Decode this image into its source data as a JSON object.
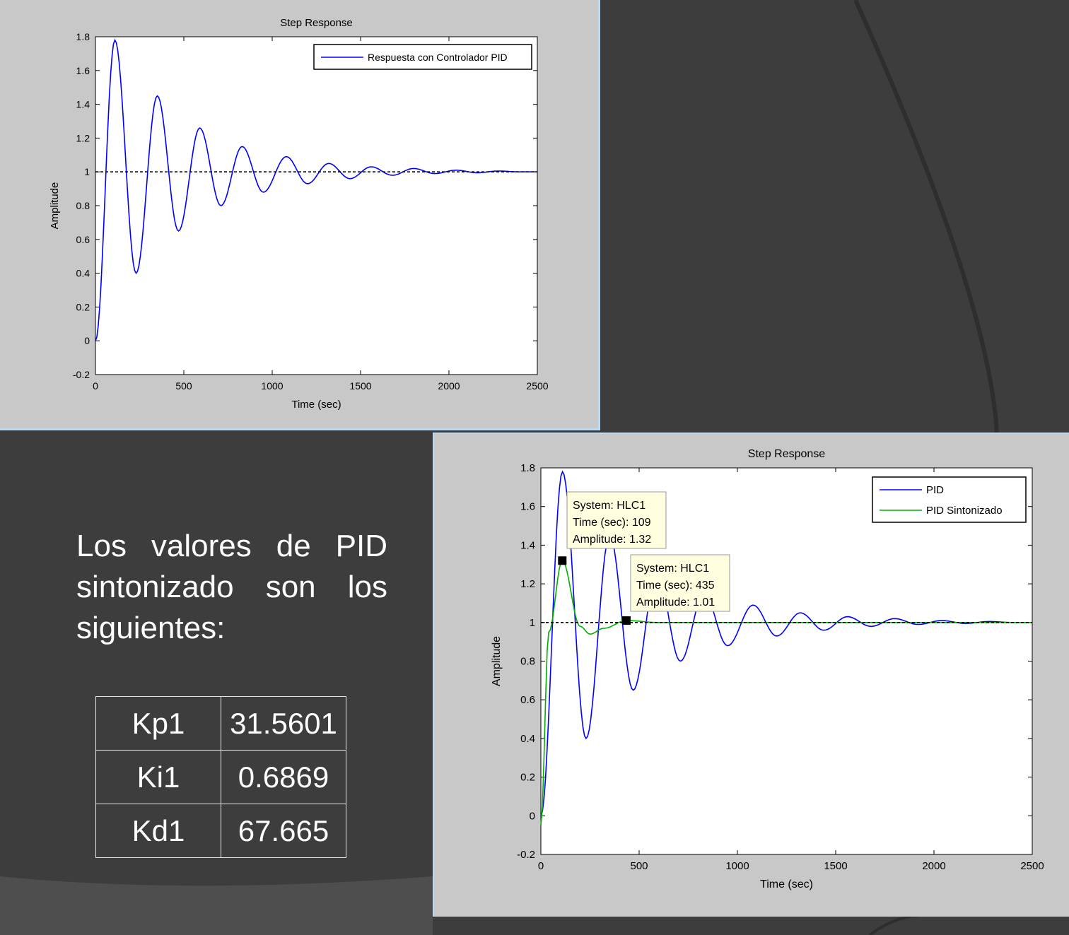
{
  "slide": {
    "description": "Los valores de PID sintonizado son los siguientes:",
    "gains_table": [
      {
        "name": "Kp1",
        "value": "31.5601"
      },
      {
        "name": "Ki1",
        "value": "0.6869"
      },
      {
        "name": "Kd1",
        "value": "67.665"
      }
    ],
    "colors": {
      "background": "#3d3d3d",
      "figure_bg": "#c8c8c8",
      "text": "#ffffff"
    }
  },
  "chart_data": [
    {
      "type": "line",
      "title": "Step Response",
      "xlabel": "Time (sec)",
      "ylabel": "Amplitude",
      "xlim": [
        0,
        2500
      ],
      "ylim": [
        -0.2,
        1.8
      ],
      "xticks": [
        "0",
        "500",
        "1000",
        "1500",
        "2000",
        "2500"
      ],
      "yticks": [
        "-0.2",
        "0",
        "0.2",
        "0.4",
        "0.6",
        "0.8",
        "1",
        "1.2",
        "1.4",
        "1.6",
        "1.8"
      ],
      "grid": false,
      "legend_position": "top-right",
      "reference_line": {
        "y": 1,
        "style": "dashed",
        "color": "#000000"
      },
      "series": [
        {
          "name": "Respuesta con Controlador PID",
          "color": "#0000ff",
          "x": [
            0,
            110,
            230,
            350,
            470,
            590,
            710,
            830,
            950,
            1080,
            1200,
            1320,
            1440,
            1560,
            1680,
            1800,
            1920,
            2040,
            2160,
            2280,
            2400,
            2500
          ],
          "y": [
            0,
            1.78,
            0.4,
            1.45,
            0.65,
            1.26,
            0.8,
            1.15,
            0.88,
            1.09,
            0.93,
            1.05,
            0.96,
            1.03,
            0.98,
            1.02,
            0.99,
            1.01,
            0.995,
            1.005,
            1.0,
            1.0
          ]
        }
      ]
    },
    {
      "type": "line",
      "title": "Step Response",
      "xlabel": "Time (sec)",
      "ylabel": "Amplitude",
      "xlim": [
        0,
        2500
      ],
      "ylim": [
        -0.2,
        1.8
      ],
      "xticks": [
        "0",
        "500",
        "1000",
        "1500",
        "2000",
        "2500"
      ],
      "yticks": [
        "-0.2",
        "0",
        "0.2",
        "0.4",
        "0.6",
        "0.8",
        "1",
        "1.2",
        "1.4",
        "1.6",
        "1.8"
      ],
      "grid": false,
      "legend_position": "top-right",
      "reference_line": {
        "y": 1,
        "style": "dashed",
        "color": "#000000"
      },
      "series": [
        {
          "name": "PID",
          "color": "#0000ff",
          "x": [
            0,
            110,
            230,
            350,
            470,
            590,
            710,
            830,
            950,
            1080,
            1200,
            1320,
            1440,
            1560,
            1680,
            1800,
            1920,
            2040,
            2160,
            2280,
            2400,
            2500
          ],
          "y": [
            0,
            1.78,
            0.4,
            1.45,
            0.65,
            1.26,
            0.8,
            1.15,
            0.88,
            1.09,
            0.93,
            1.05,
            0.96,
            1.03,
            0.98,
            1.02,
            0.99,
            1.01,
            0.995,
            1.005,
            1.0,
            1.0
          ]
        },
        {
          "name": "PID Sintonizado",
          "color": "#00b000",
          "x": [
            0,
            40,
            109,
            200,
            250,
            320,
            435,
            600,
            1000,
            1500,
            2000,
            2500
          ],
          "y": [
            -0.05,
            0.95,
            1.32,
            0.98,
            0.94,
            0.97,
            1.01,
            1.0,
            1.0,
            1.0,
            1.0,
            1.0
          ]
        }
      ],
      "datatips": [
        {
          "x": 109,
          "y": 1.32,
          "lines": [
            "System: HLC1",
            "Time (sec): 109",
            "Amplitude: 1.32"
          ]
        },
        {
          "x": 435,
          "y": 1.01,
          "lines": [
            "System: HLC1",
            "Time (sec): 435",
            "Amplitude: 1.01"
          ]
        }
      ]
    }
  ]
}
